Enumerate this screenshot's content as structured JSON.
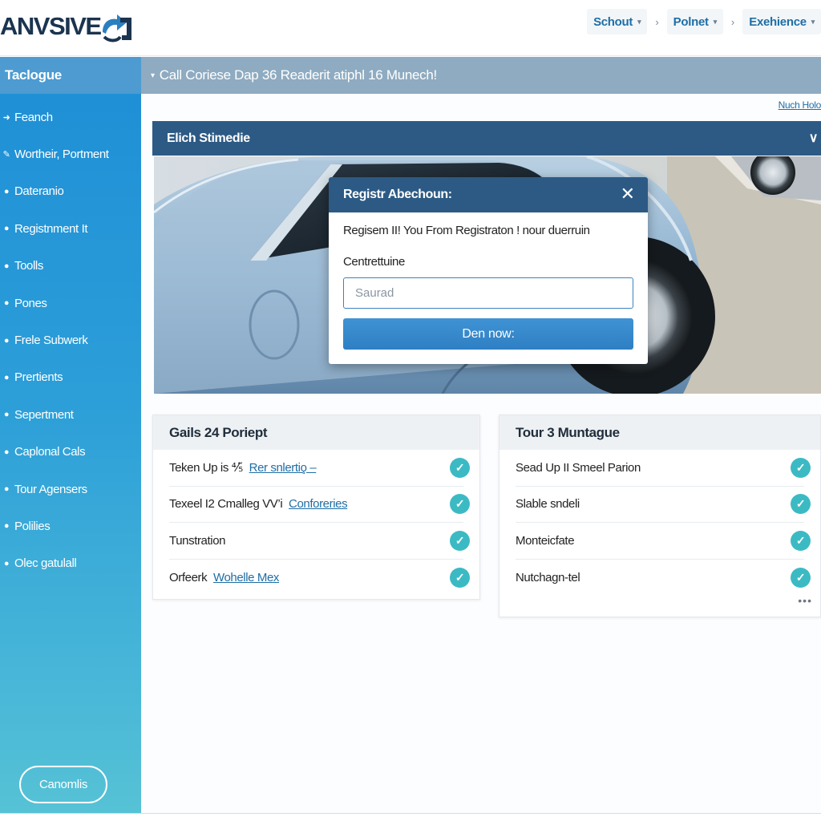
{
  "header": {
    "logo_text": "ANVSIVE",
    "nav": [
      {
        "label": "Schout"
      },
      {
        "label": "Polnet"
      },
      {
        "label": "Exehience"
      }
    ],
    "separator": "›"
  },
  "sidebar": {
    "title": "Taclogue",
    "items": [
      {
        "label": "Feanch"
      },
      {
        "label": "Wortheir, Portment"
      },
      {
        "label": "Dateranio"
      },
      {
        "label": "Registnment It"
      },
      {
        "label": "Toolls"
      },
      {
        "label": "Pones"
      },
      {
        "label": "Frele Subwerk"
      },
      {
        "label": "Prertients"
      },
      {
        "label": "Sepertment"
      },
      {
        "label": "Caplonal Cals"
      },
      {
        "label": "Tour Agensers"
      },
      {
        "label": "Polilies"
      },
      {
        "label": "Olec gatulall"
      }
    ],
    "bottom_button": "Canomlis"
  },
  "banner": {
    "text": "Call Coriese Dap 36 Readerit atiphl 16 Munech!"
  },
  "more_link": "Nuch Holo",
  "section": {
    "title": "Elich Stimedie"
  },
  "modal": {
    "title": "Registr Abechoun:",
    "description": "Regisem II! You From Registraton ! nour duerruin",
    "field_label": "Centrettuine",
    "input_placeholder": "Saurad",
    "input_value": "",
    "button_label": "Den now:",
    "close_glyph": "✕"
  },
  "cards": [
    {
      "title": "Gails 24 Poriept",
      "rows": [
        {
          "text": "Teken Up is ⅘̃ ",
          "link": "Rer snlertio̧ –"
        },
        {
          "text": "Texeel I2 Cmalleg VV’i ",
          "link": "Conforeries"
        },
        {
          "text": "Tunstration",
          "link": ""
        },
        {
          "text": "Orfeerk ",
          "link": "Wohelle Mex"
        }
      ]
    },
    {
      "title": "Tour 3 Muntague",
      "rows": [
        {
          "text": "Sead Up II Smeel Parion",
          "link": ""
        },
        {
          "text": "Slable sndeli",
          "link": ""
        },
        {
          "text": "Monteicfate",
          "link": ""
        },
        {
          "text": "Nutchagn-tel",
          "link": ""
        }
      ],
      "more": "•••"
    }
  ],
  "icons": {
    "check": "✓",
    "caret_down": "▾",
    "chevron_down": "∨",
    "bullet": "●"
  },
  "colors": {
    "brand_navy": "#1b3450",
    "sidebar_top": "#1e8ed6",
    "sidebar_bottom": "#56c2d6",
    "section_header": "#2d5a84",
    "banner": "#8eabc1",
    "accent_button": "#2e7fc3",
    "check_teal": "#3cbac4"
  }
}
